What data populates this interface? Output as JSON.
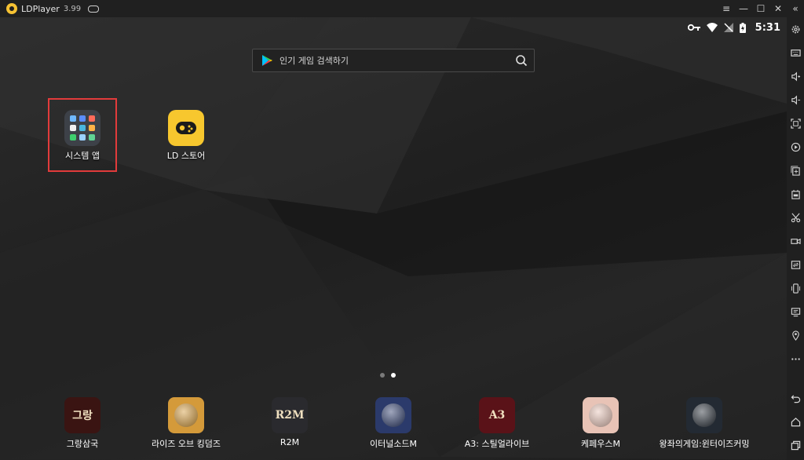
{
  "window": {
    "title": "LDPlayer",
    "version": "3.99"
  },
  "window_controls": {
    "menu_icon": "≡",
    "minimize_icon": "—",
    "maximize_icon": "☐",
    "close_icon": "✕",
    "collapse_icon": "«"
  },
  "statusbar": {
    "time": "5:31"
  },
  "search": {
    "placeholder": "인기 게임 검색하기"
  },
  "desktop": {
    "system_apps_label": "시스템 앱",
    "ld_store_label": "LD 스토어"
  },
  "page_indicator": {
    "pages": 2,
    "active": 2
  },
  "dock": [
    {
      "label": "그랑삼국",
      "icon": "grand-samguk-icon",
      "bg": "#3a1412",
      "text": "그랑"
    },
    {
      "label": "라이즈 오브 킹덤즈",
      "icon": "rise-of-kingdoms-icon",
      "bg": "#d49a3a",
      "text": ""
    },
    {
      "label": "R2M",
      "icon": "r2m-icon",
      "bg": "#2a2a2e",
      "text": "R2M"
    },
    {
      "label": "이터널소드M",
      "icon": "eternal-sword-icon",
      "bg": "#2b3a6b",
      "text": ""
    },
    {
      "label": "A3: 스틸얼라이브",
      "icon": "a3-still-alive-icon",
      "bg": "#5a1218",
      "text": "A3"
    },
    {
      "label": "케페우스M",
      "icon": "cepheus-icon",
      "bg": "#e8c3b6",
      "text": ""
    },
    {
      "label": "왕좌의게임:윈터이즈커밍",
      "icon": "game-of-thrones-icon",
      "bg": "#232a33",
      "text": ""
    }
  ]
}
